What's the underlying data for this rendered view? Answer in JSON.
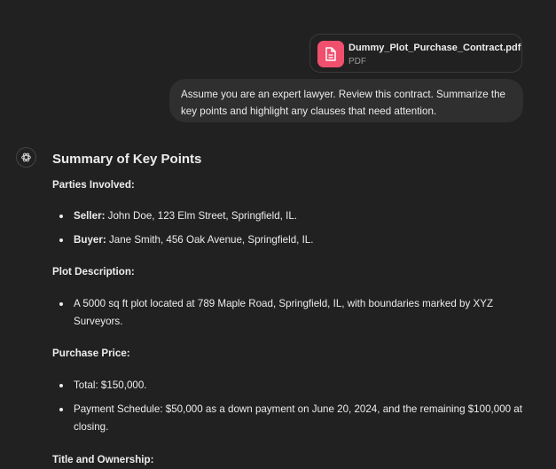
{
  "attachment": {
    "file_name": "Dummy_Plot_Purchase_Contract.pdf",
    "file_type": "PDF",
    "icon": "document-icon",
    "icon_color": "#f0506e"
  },
  "user_message": {
    "text": "Assume you are an expert lawyer. Review this contract. Summarize the key points and highlight any clauses that need attention."
  },
  "assistant": {
    "avatar_icon": "chatgpt-logo-icon",
    "heading": "Summary of Key Points",
    "sections": [
      {
        "title": "Parties Involved:",
        "items": [
          {
            "label": "Seller:",
            "text": " John Doe, 123 Elm Street, Springfield, IL."
          },
          {
            "label": "Buyer:",
            "text": " Jane Smith, 456 Oak Avenue, Springfield, IL."
          }
        ]
      },
      {
        "title": "Plot Description:",
        "items": [
          {
            "text": "A 5000 sq ft plot located at 789 Maple Road, Springfield, IL, with boundaries marked by XYZ Surveyors."
          }
        ]
      },
      {
        "title": "Purchase Price:",
        "items": [
          {
            "text": "Total: $150,000."
          },
          {
            "text": "Payment Schedule: $50,000 as a down payment on June 20, 2024, and the remaining $100,000 at closing."
          }
        ]
      },
      {
        "title": "Title and Ownership:"
      }
    ]
  }
}
